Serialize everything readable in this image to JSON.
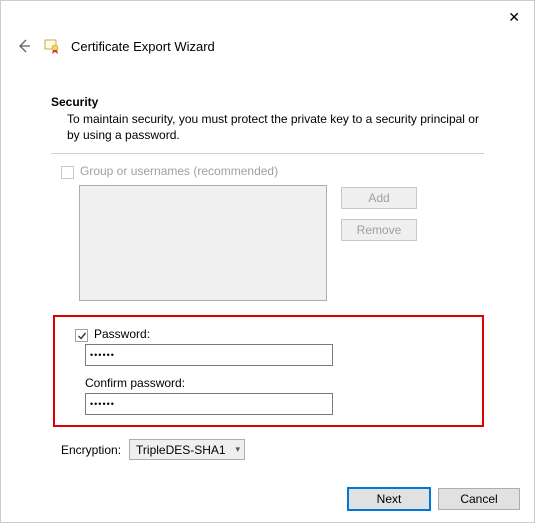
{
  "titlebar": {
    "close": "✕"
  },
  "header": {
    "title": "Certificate Export Wizard"
  },
  "security": {
    "heading": "Security",
    "description": "To maintain security, you must protect the private key to a security principal or by using a password."
  },
  "groups": {
    "checkbox_label": "Group or usernames (recommended)",
    "checked": false,
    "add_label": "Add",
    "remove_label": "Remove"
  },
  "password": {
    "checkbox_label": "Password:",
    "checked": true,
    "value": "••••••",
    "confirm_label": "Confirm password:",
    "confirm_value": "••••••"
  },
  "encryption": {
    "label": "Encryption:",
    "selected": "TripleDES-SHA1"
  },
  "footer": {
    "next": "Next",
    "cancel": "Cancel"
  }
}
